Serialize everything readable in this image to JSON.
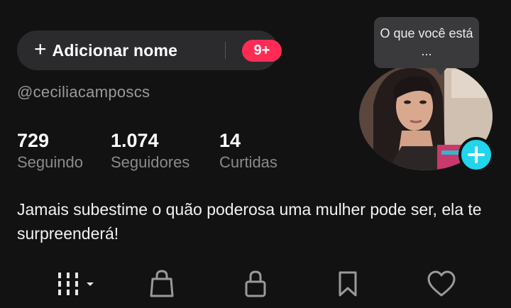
{
  "profile": {
    "add_name_label": "Adicionar nome",
    "notification_count": "9+",
    "username": "@ceciliacamposcs",
    "status_text": "O que você está ...",
    "bio": "Jamais subestime o quão poderosa uma mulher pode ser, ela te surpreenderá!"
  },
  "stats": {
    "following": {
      "value": "729",
      "label": "Seguindo"
    },
    "followers": {
      "value": "1.074",
      "label": "Seguidores"
    },
    "likes": {
      "value": "14",
      "label": "Curtidas"
    }
  },
  "tabs": [
    {
      "icon": "videos-grid-icon"
    },
    {
      "icon": "shopping-bag-icon"
    },
    {
      "icon": "lock-icon"
    },
    {
      "icon": "bookmark-icon"
    },
    {
      "icon": "heart-icon"
    }
  ],
  "colors": {
    "background": "#121212",
    "pill": "#2b2b2d",
    "badge": "#fe2c55",
    "avatar_add": "#20d5ec",
    "muted_text": "#8a8a8c"
  }
}
